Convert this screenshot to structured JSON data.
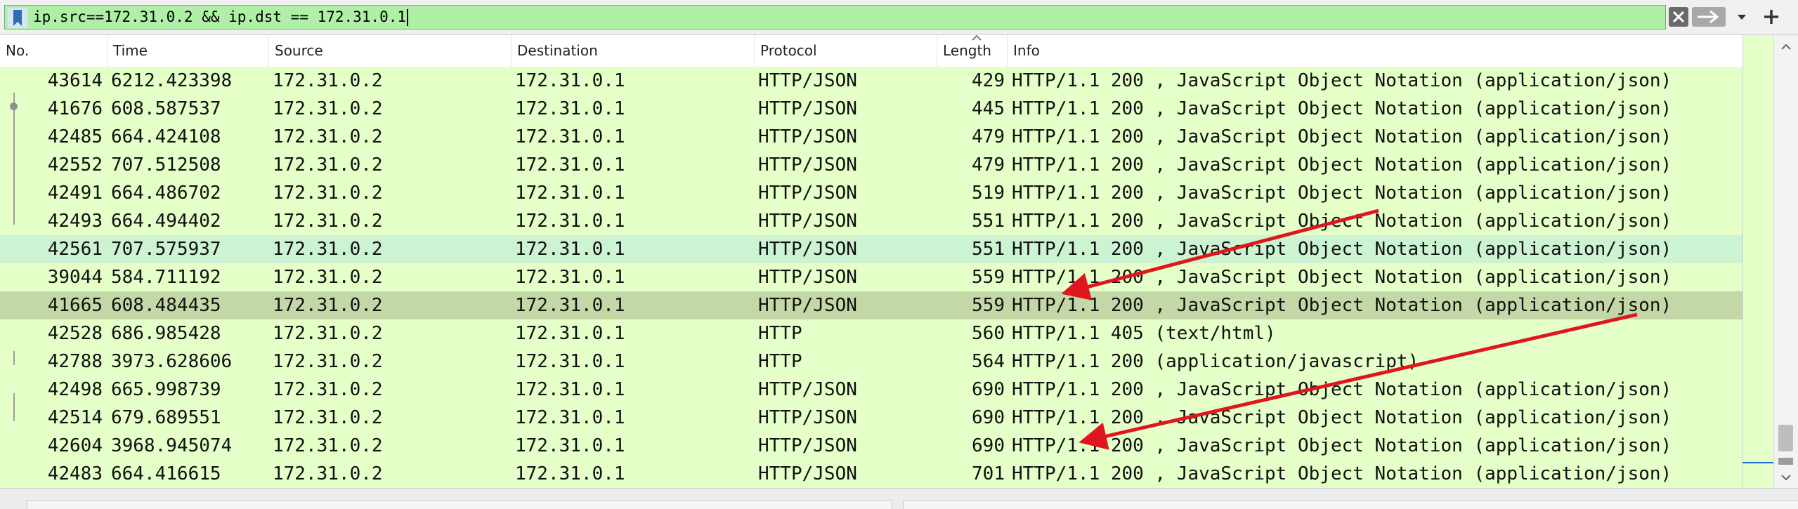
{
  "filter": {
    "value": "ip.src==172.31.0.2 && ip.dst == 172.31.0.1",
    "field_color": "#aff0a6"
  },
  "icons": {
    "bookmark": "bookmark-icon",
    "clear": "close-icon",
    "apply": "arrow-right-icon",
    "dropdown": "chevron-down-icon",
    "add": "plus-icon",
    "sort": "chevron-up-icon"
  },
  "columns": {
    "no": "No.",
    "time": "Time",
    "source": "Source",
    "destination": "Destination",
    "protocol": "Protocol",
    "length": "Length",
    "info": "Info"
  },
  "colors": {
    "row_bg": "#e4ffc7",
    "row_highlight": "#ccf4d2",
    "row_selected": "#c3d8a6",
    "annotation_arrow": "#e0161e"
  },
  "rows": [
    {
      "no": "43614",
      "time": "6212.423398",
      "src": "172.31.0.2",
      "dst": "172.31.0.1",
      "proto": "HTTP/JSON",
      "len": "429",
      "info": "HTTP/1.1 200  , JavaScript Object Notation (application/json)"
    },
    {
      "no": "41676",
      "time": "608.587537",
      "src": "172.31.0.2",
      "dst": "172.31.0.1",
      "proto": "HTTP/JSON",
      "len": "445",
      "info": "HTTP/1.1 200  , JavaScript Object Notation (application/json)"
    },
    {
      "no": "42485",
      "time": "664.424108",
      "src": "172.31.0.2",
      "dst": "172.31.0.1",
      "proto": "HTTP/JSON",
      "len": "479",
      "info": "HTTP/1.1 200  , JavaScript Object Notation (application/json)"
    },
    {
      "no": "42552",
      "time": "707.512508",
      "src": "172.31.0.2",
      "dst": "172.31.0.1",
      "proto": "HTTP/JSON",
      "len": "479",
      "info": "HTTP/1.1 200  , JavaScript Object Notation (application/json)"
    },
    {
      "no": "42491",
      "time": "664.486702",
      "src": "172.31.0.2",
      "dst": "172.31.0.1",
      "proto": "HTTP/JSON",
      "len": "519",
      "info": "HTTP/1.1 200  , JavaScript Object Notation (application/json)"
    },
    {
      "no": "42493",
      "time": "664.494402",
      "src": "172.31.0.2",
      "dst": "172.31.0.1",
      "proto": "HTTP/JSON",
      "len": "551",
      "info": "HTTP/1.1 200  , JavaScript Object Notation (application/json)"
    },
    {
      "no": "42561",
      "time": "707.575937",
      "src": "172.31.0.2",
      "dst": "172.31.0.1",
      "proto": "HTTP/JSON",
      "len": "551",
      "info": "HTTP/1.1 200  , JavaScript Object Notation (application/json)"
    },
    {
      "no": "39044",
      "time": "584.711192",
      "src": "172.31.0.2",
      "dst": "172.31.0.1",
      "proto": "HTTP/JSON",
      "len": "559",
      "info": "HTTP/1.1 200  , JavaScript Object Notation (application/json)"
    },
    {
      "no": "41665",
      "time": "608.484435",
      "src": "172.31.0.2",
      "dst": "172.31.0.1",
      "proto": "HTTP/JSON",
      "len": "559",
      "info": "HTTP/1.1 200  , JavaScript Object Notation (application/json)"
    },
    {
      "no": "42528",
      "time": "686.985428",
      "src": "172.31.0.2",
      "dst": "172.31.0.1",
      "proto": "HTTP",
      "len": "560",
      "info": "HTTP/1.1 405   (text/html)"
    },
    {
      "no": "42788",
      "time": "3973.628606",
      "src": "172.31.0.2",
      "dst": "172.31.0.1",
      "proto": "HTTP",
      "len": "564",
      "info": "HTTP/1.1 200   (application/javascript)"
    },
    {
      "no": "42498",
      "time": "665.998739",
      "src": "172.31.0.2",
      "dst": "172.31.0.1",
      "proto": "HTTP/JSON",
      "len": "690",
      "info": "HTTP/1.1 200  , JavaScript Object Notation (application/json)"
    },
    {
      "no": "42514",
      "time": "679.689551",
      "src": "172.31.0.2",
      "dst": "172.31.0.1",
      "proto": "HTTP/JSON",
      "len": "690",
      "info": "HTTP/1.1 200  , JavaScript Object Notation (application/json)"
    },
    {
      "no": "42604",
      "time": "3968.945074",
      "src": "172.31.0.2",
      "dst": "172.31.0.1",
      "proto": "HTTP/JSON",
      "len": "690",
      "info": "HTTP/1.1 200  , JavaScript Object Notation (application/json)"
    },
    {
      "no": "42483",
      "time": "664.416615",
      "src": "172.31.0.2",
      "dst": "172.31.0.1",
      "proto": "HTTP/JSON",
      "len": "701",
      "info": "HTTP/1.1 200  , JavaScript Object Notation (application/json)"
    }
  ]
}
